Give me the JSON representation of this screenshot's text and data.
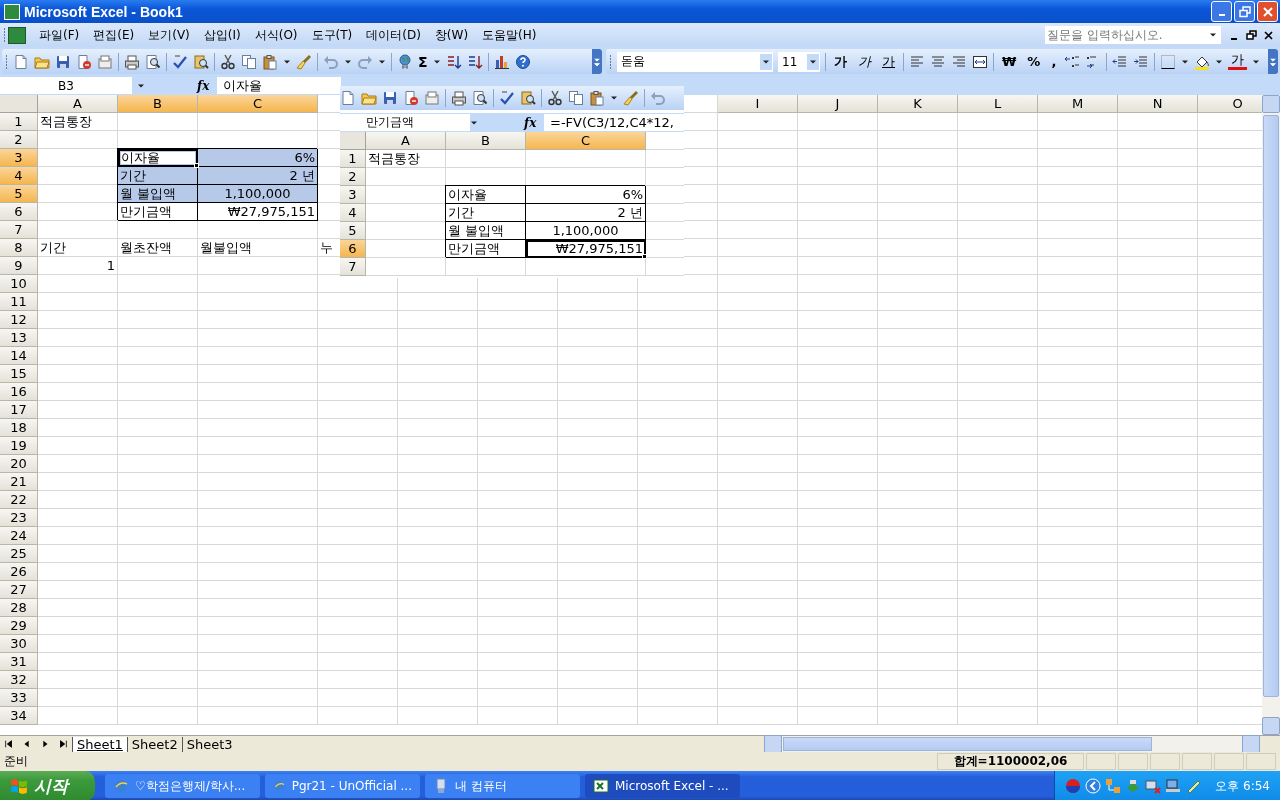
{
  "window": {
    "title": "Microsoft Excel - Book1"
  },
  "menu": {
    "items": [
      "파일(F)",
      "편집(E)",
      "보기(V)",
      "삽입(I)",
      "서식(O)",
      "도구(T)",
      "데이터(D)",
      "창(W)",
      "도움말(H)"
    ],
    "help_box": {
      "placeholder": "질문을 입력하십시오."
    }
  },
  "toolbar": {
    "sum": "Σ",
    "font": "돋움",
    "font_size": "11",
    "style_buttons": [
      {
        "label": "가",
        "kind": "bold"
      },
      {
        "label": "가",
        "kind": "italic"
      },
      {
        "label": "가",
        "kind": "underline"
      }
    ],
    "number_buttons": [
      "₩",
      "%",
      ","
    ],
    "font_color": "가"
  },
  "formula_bar": {
    "name_box": "B3",
    "fx": "fx",
    "formula": "이자율"
  },
  "sheet": {
    "columns": [
      {
        "label": "A",
        "selected": false,
        "kind": "normal"
      },
      {
        "label": "B",
        "selected": true,
        "kind": "normal"
      },
      {
        "label": "C",
        "selected": true,
        "kind": "wide"
      },
      {
        "kind": "normal"
      },
      {
        "kind": "normal"
      },
      {
        "kind": "normal"
      },
      {
        "kind": "normal"
      },
      {
        "kind": "normal"
      },
      {
        "label": "I",
        "selected": false,
        "kind": "normal"
      },
      {
        "label": "J",
        "selected": false,
        "kind": "normal"
      },
      {
        "label": "K",
        "selected": false,
        "kind": "normal"
      },
      {
        "label": "L",
        "selected": false,
        "kind": "normal"
      },
      {
        "label": "M",
        "selected": false,
        "kind": "normal"
      },
      {
        "label": "N",
        "selected": false,
        "kind": "normal"
      },
      {
        "label": "O",
        "selected": false,
        "kind": "normal"
      }
    ],
    "rows": [
      {
        "label": "1",
        "selected": false,
        "cells": [
          {
            "text": "적금통장",
            "kind": "text",
            "selected": false,
            "active": false,
            "boxed": false
          }
        ]
      },
      {
        "label": "2",
        "selected": false
      },
      {
        "label": "3",
        "selected": true,
        "cells": [
          {
            "kind": "empty"
          },
          {
            "text": "이자율",
            "kind": "text",
            "selected": true,
            "active": true,
            "boxed": true
          },
          {
            "text": "6%",
            "kind": "number",
            "selected": true,
            "active": false,
            "boxed": true
          }
        ]
      },
      {
        "label": "4",
        "selected": true,
        "cells": [
          {
            "kind": "empty"
          },
          {
            "text": "기간",
            "kind": "text",
            "selected": true,
            "active": false,
            "boxed": true
          },
          {
            "text": "2 년",
            "kind": "number",
            "selected": true,
            "active": false,
            "boxed": true
          }
        ]
      },
      {
        "label": "5",
        "selected": true,
        "cells": [
          {
            "kind": "empty"
          },
          {
            "text": "월 불입액",
            "kind": "text",
            "selected": true,
            "active": false,
            "boxed": true
          },
          {
            "text": "1,100,000",
            "kind": "center",
            "selected": true,
            "active": false,
            "boxed": true
          }
        ]
      },
      {
        "label": "6",
        "selected": false,
        "cells": [
          {
            "kind": "empty"
          },
          {
            "text": "만기금액",
            "kind": "text",
            "selected": false,
            "active": false,
            "boxed": true
          },
          {
            "text": "₩27,975,151",
            "kind": "number",
            "selected": false,
            "active": false,
            "boxed": true
          }
        ]
      },
      {
        "label": "7",
        "selected": false
      },
      {
        "label": "8",
        "selected": false,
        "cells": [
          {
            "text": "기간",
            "kind": "text",
            "selected": false,
            "active": false,
            "boxed": false
          },
          {
            "text": "월초잔액",
            "kind": "text",
            "selected": false,
            "active": false,
            "boxed": false
          },
          {
            "text": "월불입액",
            "kind": "text",
            "selected": false,
            "active": false,
            "boxed": false
          },
          {
            "text": "누",
            "kind": "text",
            "selected": false,
            "active": false,
            "boxed": false
          }
        ]
      },
      {
        "label": "9",
        "selected": false,
        "cells": [
          {
            "text": "1",
            "kind": "number",
            "selected": false,
            "active": false,
            "boxed": false
          }
        ]
      },
      {
        "label": "10",
        "selected": false
      },
      {
        "label": "11",
        "selected": false
      },
      {
        "label": "12",
        "selected": false
      },
      {
        "label": "13",
        "selected": false
      },
      {
        "label": "14",
        "selected": false
      },
      {
        "label": "15",
        "selected": false
      },
      {
        "label": "16",
        "selected": false
      },
      {
        "label": "17",
        "selected": false
      },
      {
        "label": "18",
        "selected": false
      },
      {
        "label": "19",
        "selected": false
      },
      {
        "label": "20",
        "selected": false
      },
      {
        "label": "21",
        "selected": false
      },
      {
        "label": "22",
        "selected": false
      },
      {
        "label": "23",
        "selected": false
      },
      {
        "label": "24",
        "selected": false
      },
      {
        "label": "25",
        "selected": false
      },
      {
        "label": "26",
        "selected": false
      },
      {
        "label": "27",
        "selected": false
      },
      {
        "label": "28",
        "selected": false
      },
      {
        "label": "29",
        "selected": false
      },
      {
        "label": "30",
        "selected": false
      },
      {
        "label": "31",
        "selected": false
      },
      {
        "label": "32",
        "selected": false
      },
      {
        "label": "33",
        "selected": false
      },
      {
        "label": "34",
        "selected": false
      }
    ]
  },
  "inset": {
    "name_box": "만기금액",
    "fx": "fx",
    "formula": "=-FV(C3/12,C4*12,",
    "columns": [
      {
        "label": "A",
        "selected": false,
        "kind": "normal"
      },
      {
        "label": "B",
        "selected": false,
        "kind": "normal"
      },
      {
        "label": "C",
        "selected": true,
        "kind": "wide"
      },
      {
        "kind": "normal"
      }
    ],
    "rows": [
      {
        "label": "1",
        "selected": false,
        "cells": [
          {
            "text": "적금통장",
            "kind": "text",
            "active": false,
            "boxed": false
          }
        ]
      },
      {
        "label": "2",
        "selected": false
      },
      {
        "label": "3",
        "selected": false,
        "cells": [
          {
            "kind": "empty"
          },
          {
            "text": "이자율",
            "kind": "text",
            "active": false,
            "boxed": true
          },
          {
            "text": "6%",
            "kind": "number",
            "active": false,
            "boxed": true
          }
        ]
      },
      {
        "label": "4",
        "selected": false,
        "cells": [
          {
            "kind": "empty"
          },
          {
            "text": "기간",
            "kind": "text",
            "active": false,
            "boxed": true
          },
          {
            "text": "2 년",
            "kind": "number",
            "active": false,
            "boxed": true
          }
        ]
      },
      {
        "label": "5",
        "selected": false,
        "cells": [
          {
            "kind": "empty"
          },
          {
            "text": "월 불입액",
            "kind": "text",
            "active": false,
            "boxed": true
          },
          {
            "text": "1,100,000",
            "kind": "center",
            "active": false,
            "boxed": true
          }
        ]
      },
      {
        "label": "6",
        "selected": true,
        "cells": [
          {
            "kind": "empty"
          },
          {
            "text": "만기금액",
            "kind": "text",
            "active": false,
            "boxed": true
          },
          {
            "text": "₩27,975,151",
            "kind": "number",
            "active": true,
            "boxed": true
          }
        ]
      },
      {
        "label": "7",
        "selected": false
      }
    ]
  },
  "sheet_tabs": [
    {
      "label": "Sheet1",
      "selected": true
    },
    {
      "label": "Sheet2",
      "selected": false
    },
    {
      "label": "Sheet3",
      "selected": false
    }
  ],
  "status_bar": {
    "mode": "준비",
    "sum": "합계=1100002,06"
  },
  "taskbar": {
    "start": "시작",
    "tasks": [
      {
        "label": "♡학점은행제/학사...",
        "selected": false,
        "kind": "browser"
      },
      {
        "label": "Pgr21 - UnOfficial ...",
        "selected": false,
        "kind": "browser"
      },
      {
        "label": "내 컴퓨터",
        "selected": false,
        "kind": "computer"
      },
      {
        "label": "Microsoft Excel - ...",
        "selected": true,
        "kind": "excel"
      }
    ],
    "clock": "오후 6:54"
  }
}
